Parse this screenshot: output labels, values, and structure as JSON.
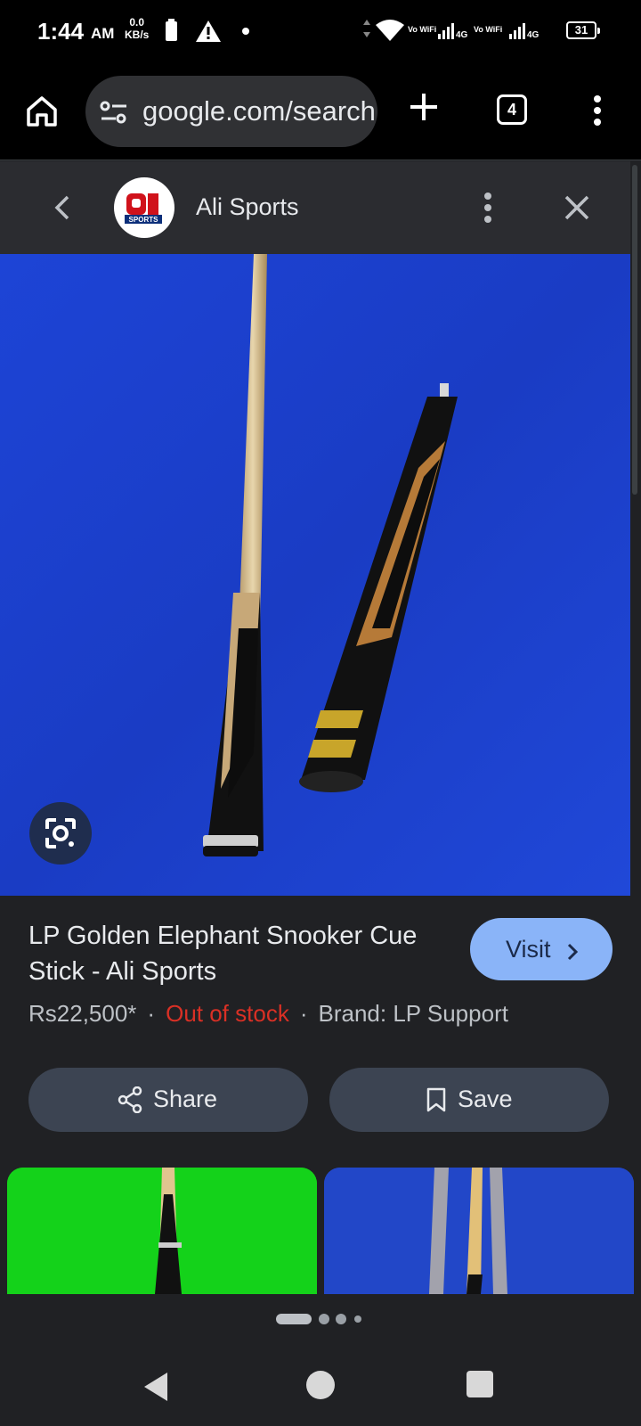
{
  "status_bar": {
    "time": "1:44",
    "ampm": "AM",
    "net_speed_value": "0.0",
    "net_speed_unit": "KB/s",
    "vowifi_1": "Vo WiFi",
    "network_1": "4G",
    "vowifi_2": "Vo WiFi",
    "network_2": "4G",
    "battery_level": "31",
    "icons": [
      "battery-icon",
      "warning-icon",
      "dot-icon",
      "data-arrows-icon",
      "wifi-icon",
      "signal-icon",
      "signal-icon"
    ]
  },
  "toolbar": {
    "url": "google.com/search",
    "tab_count": "4",
    "icons": [
      "home-icon",
      "tune-icon",
      "plus-icon",
      "more-vert-icon"
    ]
  },
  "panel": {
    "source_name": "Ali Sports",
    "logo_text": "SPORTS",
    "icons": [
      "chevron-left-icon",
      "more-vert-icon",
      "close-icon"
    ]
  },
  "product": {
    "title": "LP Golden Elephant Snooker Cue Stick - Ali Sports",
    "visit_label": "Visit",
    "price": "Rs22,500*",
    "stock_status": "Out of stock",
    "brand": "Brand: LP Support",
    "share_label": "Share",
    "save_label": "Save"
  },
  "colors": {
    "background": "#202124",
    "accent": "#8ab4f8",
    "out_of_stock": "#d93025",
    "image_blue": "#1c3fcb",
    "thumb_green": "#14d21a"
  },
  "carousel": {
    "page_count": 4,
    "active_index": 0
  },
  "nav": {
    "icons": [
      "back-triangle-icon",
      "home-circle-icon",
      "recents-square-icon"
    ]
  }
}
